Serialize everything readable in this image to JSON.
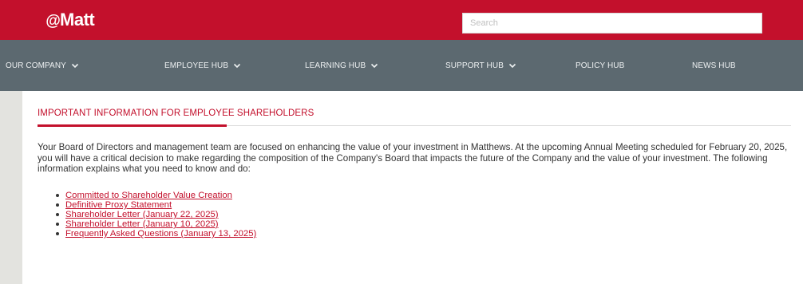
{
  "header": {
    "logo_text": "Matt",
    "logo_prefix": "@",
    "search_placeholder": "Search"
  },
  "nav": {
    "items": [
      {
        "label": "OUR COMPANY",
        "has_dropdown": true
      },
      {
        "label": "EMPLOYEE HUB",
        "has_dropdown": true
      },
      {
        "label": "LEARNING HUB",
        "has_dropdown": true
      },
      {
        "label": "SUPPORT HUB",
        "has_dropdown": true
      },
      {
        "label": "POLICY HUB",
        "has_dropdown": false
      },
      {
        "label": "NEWS HUB",
        "has_dropdown": false
      }
    ],
    "chevron_icon": "chevron-down-icon"
  },
  "main": {
    "section_title": "IMPORTANT INFORMATION FOR EMPLOYEE SHAREHOLDERS",
    "paragraph": "Your Board of Directors and management team are focused on enhancing the value of your investment in Matthews. At the upcoming Annual Meeting scheduled for February 20, 2025, you will have a critical decision to make regarding the composition of the Company's Board that impacts the future of the Company and the value of your investment. The following information explains what you need to know and do:",
    "links": [
      "Committed to Shareholder Value Creation",
      "Definitive Proxy Statement",
      "Shareholder Letter (January 22, 2025)",
      "Shareholder Letter (January 10, 2025)",
      "Frequently Asked Questions (January 13, 2025)"
    ]
  },
  "colors": {
    "brand_red": "#c3102c",
    "nav_gray": "#5c6970",
    "page_bg": "#e6e6e3",
    "text": "#333333"
  }
}
